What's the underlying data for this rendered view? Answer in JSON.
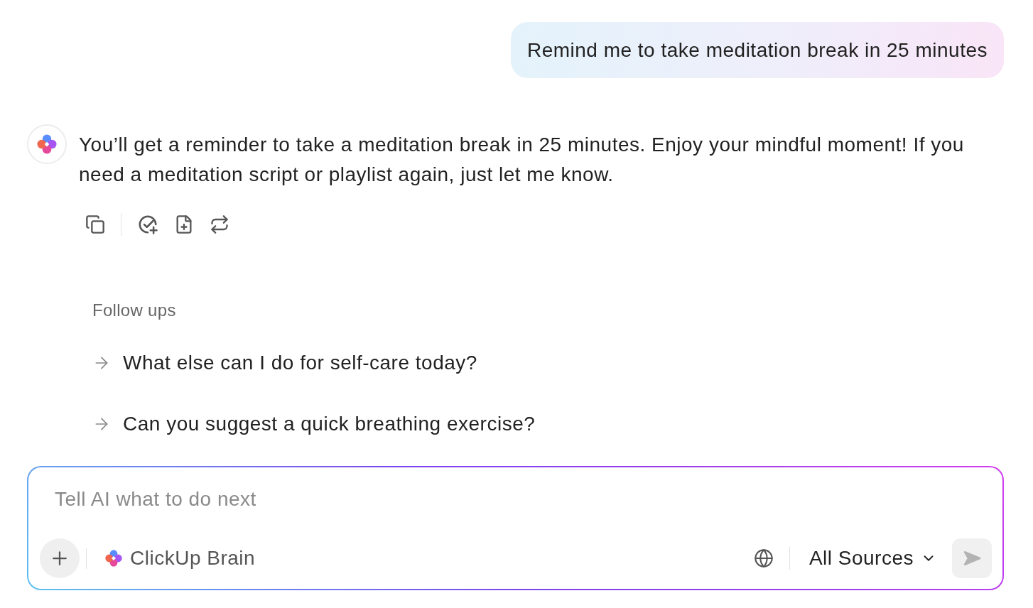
{
  "user_message": {
    "text": "Remind me to take meditation break in 25 minutes"
  },
  "assistant_message": {
    "text": "You’ll get a reminder to take a meditation break in 25 minutes. Enjoy your mindful moment! If you need a meditation script or playlist again, just let me know."
  },
  "follow_ups": {
    "title": "Follow ups",
    "items": [
      "What else can I do for self-care today?",
      "Can you suggest a quick breathing exercise?"
    ]
  },
  "composer": {
    "placeholder": "Tell AI what to do next",
    "assistant_name": "ClickUp Brain",
    "sources": "All Sources",
    "send_button": {
      "disabled": true
    }
  }
}
